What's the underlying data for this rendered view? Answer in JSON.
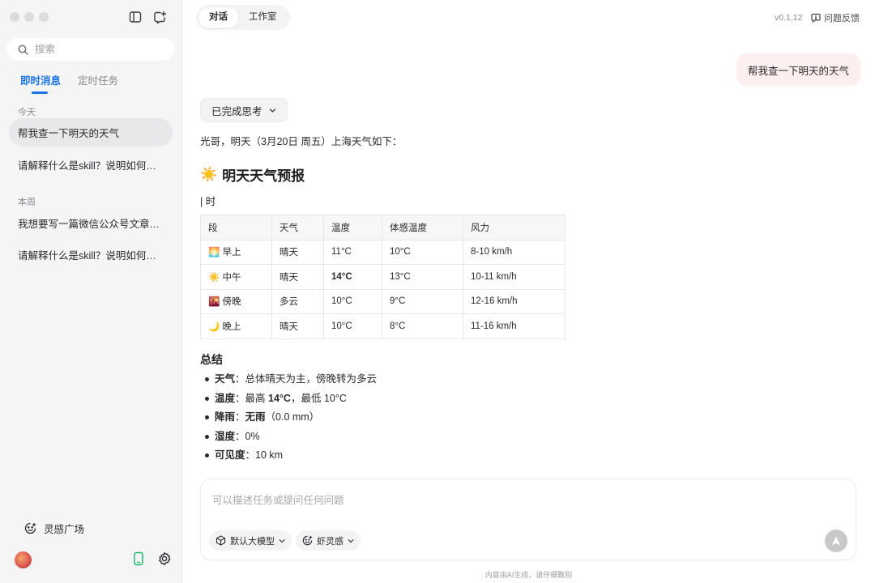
{
  "sidebar": {
    "search_placeholder": "搜索",
    "tabs": [
      {
        "label": "即时消息",
        "active": true
      },
      {
        "label": "定时任务",
        "active": false
      }
    ],
    "groups": [
      {
        "label": "今天",
        "items": [
          "帮我查一下明天的天气",
          "请解释什么是skill？说明如何安装"
        ]
      },
      {
        "label": "本周",
        "items": [
          "我想要写一篇微信公众号文章，帮我",
          "请解释什么是skill？说明如何安装"
        ]
      }
    ],
    "inspire_label": "灵感广场",
    "accent_color": "#1a73e8"
  },
  "header": {
    "tabs": [
      {
        "label": "对话",
        "active": true
      },
      {
        "label": "工作室",
        "active": false
      }
    ],
    "version": "v0.1.12",
    "feedback_label": "问题反馈"
  },
  "chat": {
    "user_message": "帮我查一下明天的天气",
    "thinking_label": "已完成思考",
    "intro": "光哥，明天（3月20日 周五）上海天气如下：",
    "heading_icon": "☀️",
    "heading": "明天天气预报",
    "pipe_text": "| 时",
    "table": {
      "headers": [
        "段",
        "天气",
        "温度",
        "体感温度",
        "风力"
      ],
      "rows": [
        {
          "icon": "🌅",
          "period": "早上",
          "weather": "晴天",
          "temp": "11°C",
          "feels": "10°C",
          "wind": "8-10 km/h",
          "bold_temp": false
        },
        {
          "icon": "☀️",
          "period": "中午",
          "weather": "晴天",
          "temp": "14°C",
          "feels": "13°C",
          "wind": "10-11 km/h",
          "bold_temp": true
        },
        {
          "icon": "🌇",
          "period": "傍晚",
          "weather": "多云",
          "temp": "10°C",
          "feels": "9°C",
          "wind": "12-16 km/h",
          "bold_temp": false
        },
        {
          "icon": "🌙",
          "period": "晚上",
          "weather": "晴天",
          "temp": "10°C",
          "feels": "8°C",
          "wind": "11-16 km/h",
          "bold_temp": false
        }
      ]
    },
    "summary_title": "总结",
    "summary": [
      {
        "key": "天气",
        "parts": [
          {
            "t": "：总体晴天为主，傍晚转为多云",
            "b": false
          }
        ]
      },
      {
        "key": "温度",
        "parts": [
          {
            "t": "：最高 ",
            "b": false
          },
          {
            "t": "14°C",
            "b": true
          },
          {
            "t": "，最低 10°C",
            "b": false
          }
        ]
      },
      {
        "key": "降雨",
        "parts": [
          {
            "t": "：",
            "b": false
          },
          {
            "t": "无雨",
            "b": true
          },
          {
            "t": "（0.0 mm）",
            "b": false
          }
        ]
      },
      {
        "key": "湿度",
        "parts": [
          {
            "t": "：0%",
            "b": false
          }
        ]
      },
      {
        "key": "可见度",
        "parts": [
          {
            "t": "：10 km",
            "b": false
          }
        ]
      }
    ]
  },
  "composer": {
    "placeholder": "可以描述任务或提问任何问题",
    "model_label": "默认大模型",
    "inspire_chip_label": "虾灵感"
  },
  "footer": {
    "disclaimer": "内容由AI生成，请仔细甄别"
  }
}
